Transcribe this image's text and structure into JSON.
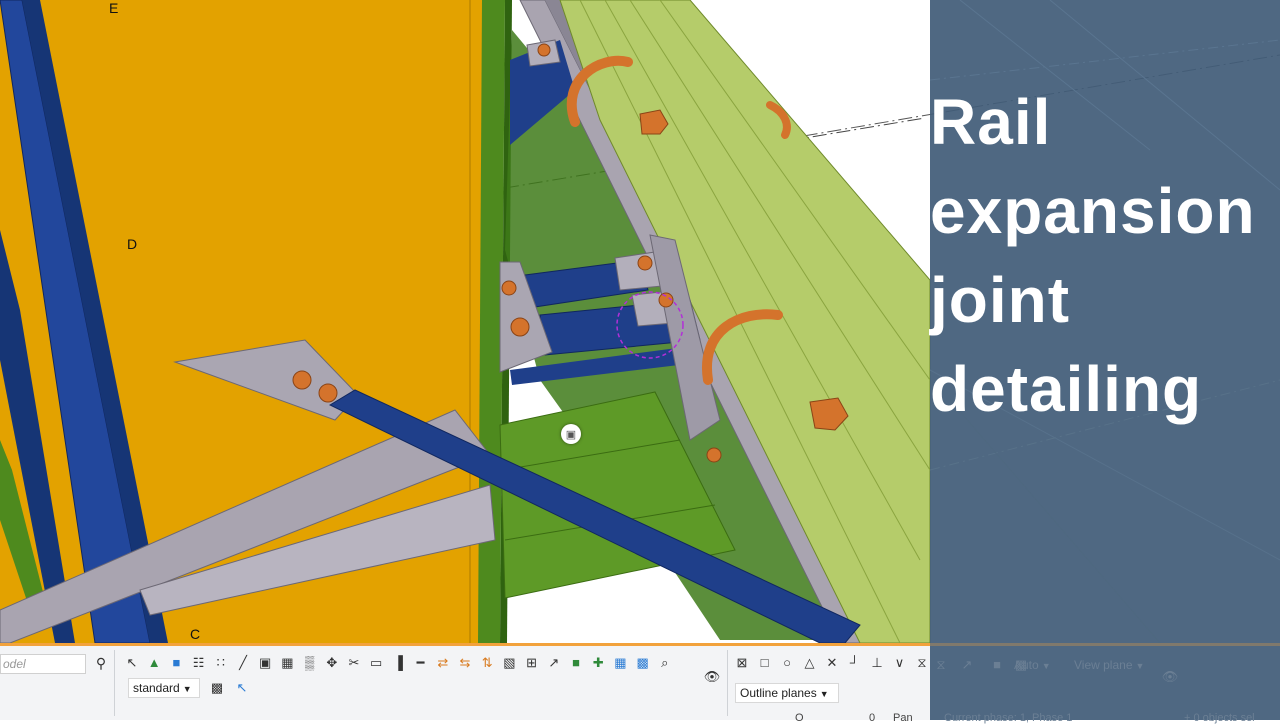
{
  "viewport": {
    "grid_labels": [
      "E",
      "D",
      "C"
    ]
  },
  "overlay": {
    "title_lines": [
      "Rail",
      "expansion",
      "joint",
      "detailing"
    ]
  },
  "toolbar": {
    "search_placeholder": "odel",
    "representation_select": "standard",
    "outline_select": "Outline planes",
    "work_area_select": "Auto",
    "view_plane_select": "View plane",
    "icons_selection": [
      "pointer-icon",
      "tree-icon",
      "blue-square-icon",
      "grid-select-icon",
      "dots-icon",
      "line-icon",
      "cube-icon",
      "grid-icon",
      "pattern-icon",
      "move-icon",
      "cut-icon",
      "rect-icon",
      "align-icon",
      "beam-icon",
      "snap-a-icon",
      "snap-b-icon",
      "snap-c-icon",
      "bracket-icon",
      "layers-icon",
      "arrow-icon",
      "green-square-icon",
      "plus-icon",
      "grid-blue-icon",
      "grid-blue2-icon",
      "zoom-icon"
    ],
    "icons_snap": [
      "box-x-icon",
      "square-icon",
      "circle-icon",
      "triangle-icon",
      "x-icon",
      "corner-icon",
      "perp-icon",
      "chevron-icon",
      "hourglass-icon"
    ]
  },
  "status": {
    "coord_label": "O",
    "coord_value": "0",
    "mode": "Pan",
    "phase": "Current phase: 1, Phase 1",
    "selection": "+ 0 objects sel"
  },
  "colors": {
    "panel": "#425c78",
    "toolbar_accent": "#f2a23c",
    "yellow_plate": "#e3a200",
    "blue_beam": "#1f3f8a",
    "green_member": "#6a9a2c",
    "rail": "#b5cc6a",
    "bolt": "#d4732c"
  }
}
